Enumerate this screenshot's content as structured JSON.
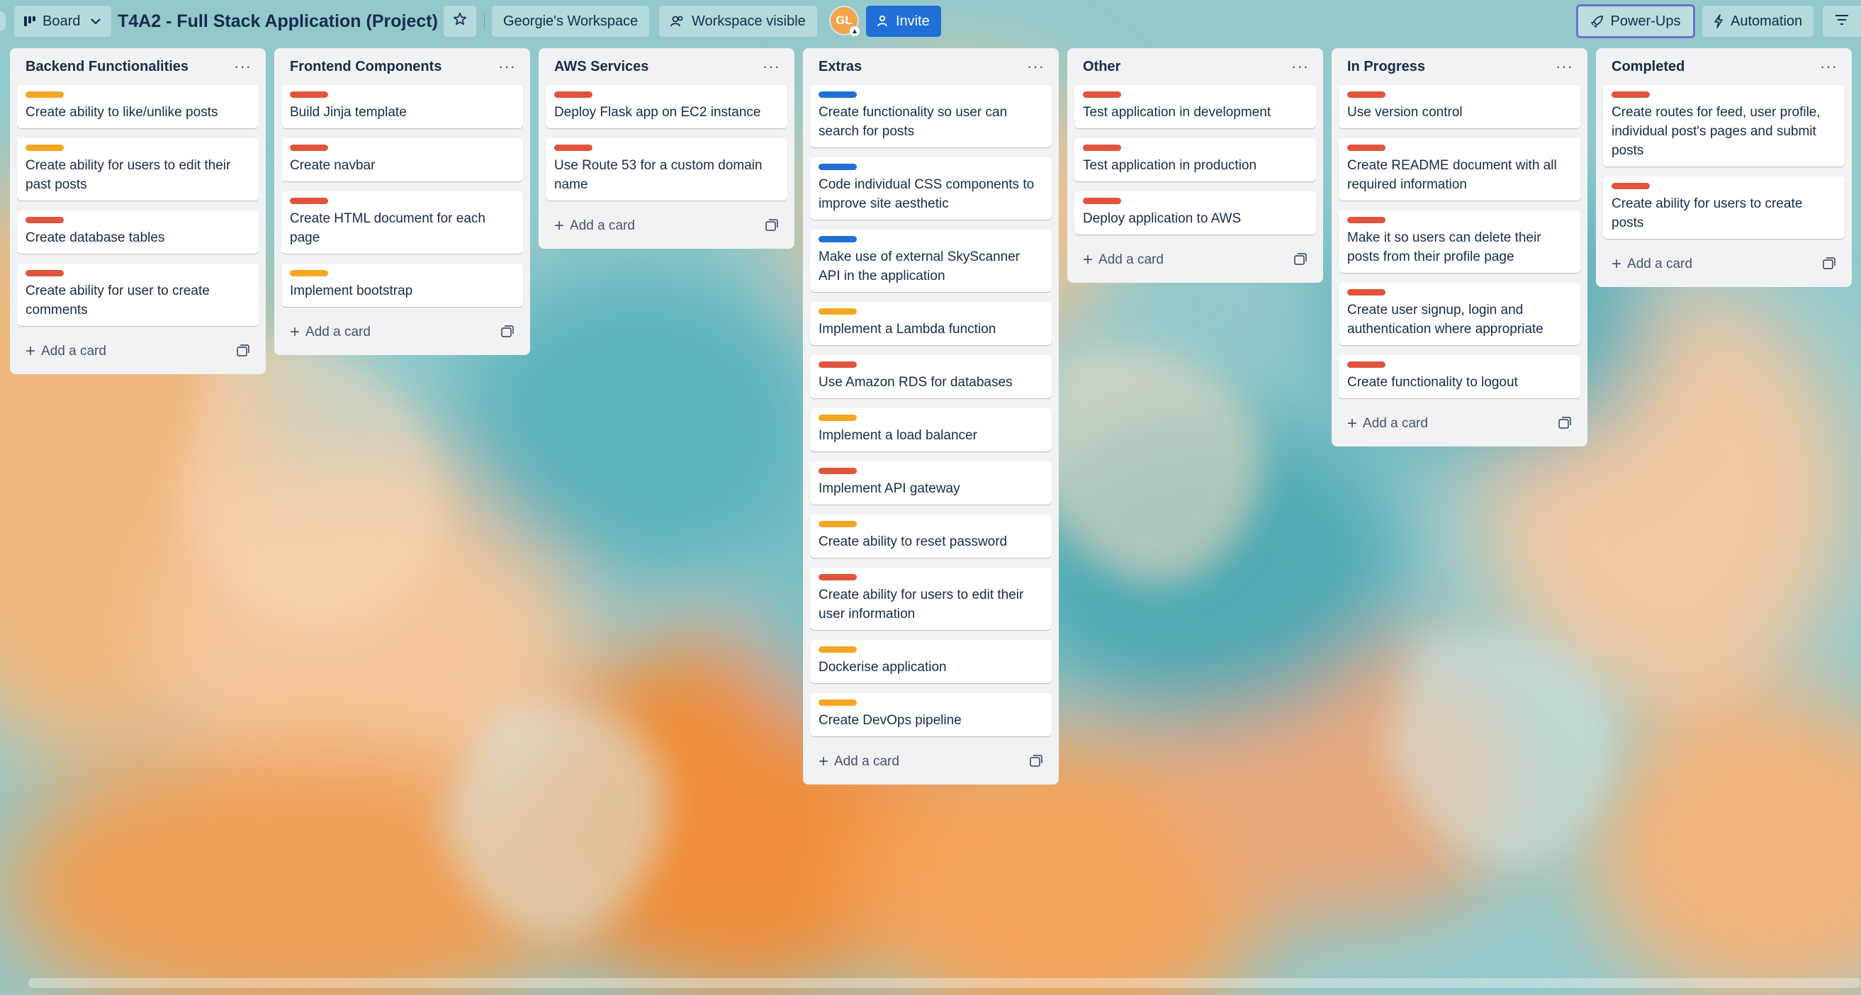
{
  "header": {
    "view_switcher": "Board",
    "board_title": "T4A2 - Full Stack Application (Project)",
    "workspace": "Georgie's Workspace",
    "visibility": "Workspace visible",
    "avatar_initials": "GL",
    "invite": "Invite",
    "power_ups": "Power-Ups",
    "automation": "Automation"
  },
  "colors": {
    "red": "#e2533d",
    "orange": "#f5a623",
    "blue": "#1f6fd6"
  },
  "add_card_label": "Add a card",
  "lists": [
    {
      "title": "Backend Functionalities",
      "cards": [
        {
          "label": "orange",
          "text": "Create ability to like/unlike posts"
        },
        {
          "label": "orange",
          "text": "Create ability for users to edit their past posts"
        },
        {
          "label": "red",
          "text": "Create database tables"
        },
        {
          "label": "red",
          "text": "Create ability for user to create comments"
        }
      ]
    },
    {
      "title": "Frontend Components",
      "cards": [
        {
          "label": "red",
          "text": "Build Jinja template"
        },
        {
          "label": "red",
          "text": "Create navbar"
        },
        {
          "label": "red",
          "text": "Create HTML document for each page"
        },
        {
          "label": "orange",
          "text": "Implement bootstrap"
        }
      ]
    },
    {
      "title": "AWS Services",
      "cards": [
        {
          "label": "red",
          "text": "Deploy Flask app on EC2 instance"
        },
        {
          "label": "red",
          "text": "Use Route 53 for a custom domain name"
        }
      ]
    },
    {
      "title": "Extras",
      "cards": [
        {
          "label": "blue",
          "text": "Create functionality so user can search for posts"
        },
        {
          "label": "blue",
          "text": "Code individual CSS components to improve site aesthetic"
        },
        {
          "label": "blue",
          "text": "Make use of external SkyScanner API in the application"
        },
        {
          "label": "orange",
          "text": "Implement a Lambda function"
        },
        {
          "label": "red",
          "text": "Use Amazon RDS for databases"
        },
        {
          "label": "orange",
          "text": "Implement a load balancer"
        },
        {
          "label": "red",
          "text": "Implement API gateway"
        },
        {
          "label": "orange",
          "text": "Create ability to reset password"
        },
        {
          "label": "red",
          "text": "Create ability for users to edit their user information"
        },
        {
          "label": "orange",
          "text": "Dockerise application"
        },
        {
          "label": "orange",
          "text": "Create DevOps pipeline"
        }
      ]
    },
    {
      "title": "Other",
      "cards": [
        {
          "label": "red",
          "text": "Test application in development"
        },
        {
          "label": "red",
          "text": "Test application in production"
        },
        {
          "label": "red",
          "text": "Deploy application to AWS"
        }
      ]
    },
    {
      "title": "In Progress",
      "cards": [
        {
          "label": "red",
          "text": "Use version control"
        },
        {
          "label": "red",
          "text": "Create README document with all required information"
        },
        {
          "label": "red",
          "text": "Make it so users can delete their posts from their profile page"
        },
        {
          "label": "red",
          "text": "Create user signup, login and authentication where appropriate"
        },
        {
          "label": "red",
          "text": "Create functionality to logout"
        }
      ]
    },
    {
      "title": "Completed",
      "cards": [
        {
          "label": "red",
          "text": "Create routes for feed, user profile, individual post's pages and submit posts"
        },
        {
          "label": "red",
          "text": "Create ability for users to create posts"
        }
      ]
    }
  ]
}
